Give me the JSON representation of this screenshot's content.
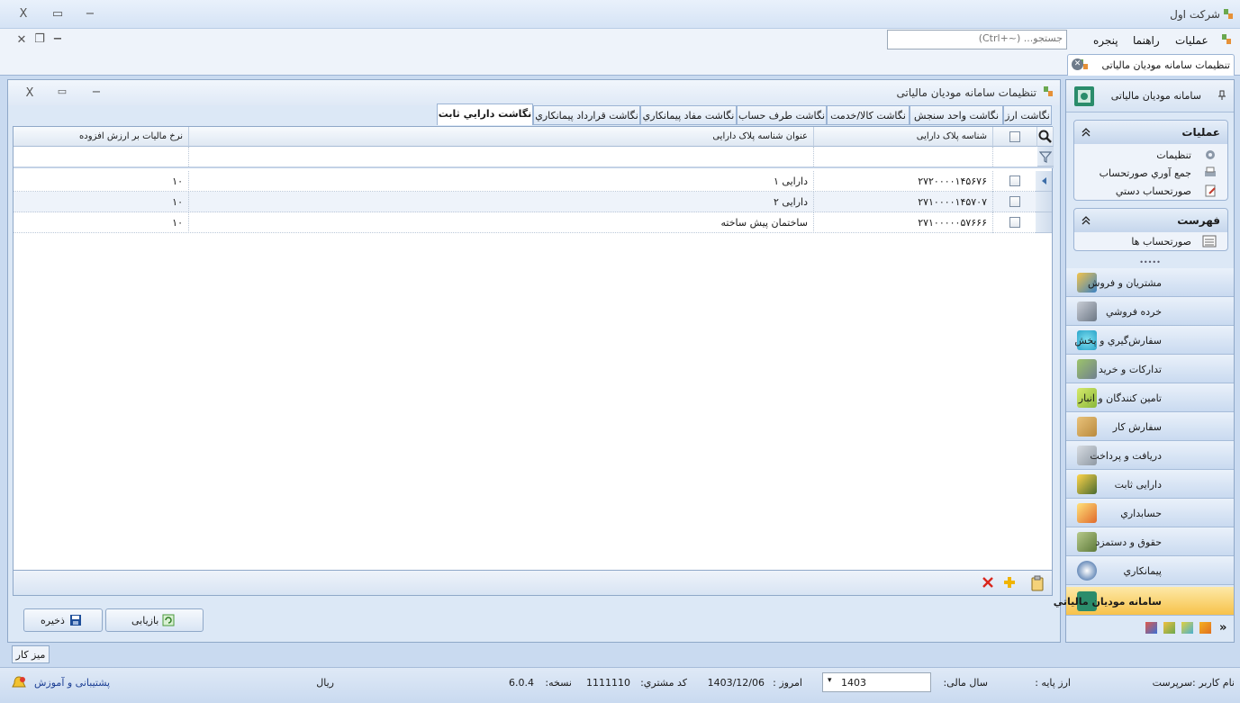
{
  "window": {
    "title": "شرکت اول",
    "min_glyph": "−",
    "max_glyph": "▭",
    "close_glyph": "X"
  },
  "mdi_controls": {
    "close_glyph": "✕",
    "restore_glyph": "❐",
    "min_glyph": "−"
  },
  "menu": {
    "items": [
      "عملیات",
      "راهنما",
      "پنجره"
    ]
  },
  "search": {
    "placeholder": "جستجو... (~+Ctrl)"
  },
  "doc_tab": {
    "label": "تنظیمات سامانه مودیان مالیاتی",
    "close_glyph": "✕"
  },
  "dialog": {
    "title": "تنظیمات سامانه مودیان مالیاتی",
    "close_glyph": "X",
    "restore_glyph": "▭",
    "min_glyph": "−"
  },
  "subtabs": [
    "نگاشت ارز",
    "نگاشت واحد سنجش",
    "نگاشت کالا/خدمت",
    "نگاشت طرف حساب",
    "نگاشت مفاد پیمانکاري",
    "نگاشت قرارداد پیمانکاري",
    "نگاشت دارايي ثابت"
  ],
  "grid": {
    "columns": [
      "شناسه پلاک دارایی",
      "عنوان شناسه پلاک دارایی",
      "نرخ مالیات بر ارزش افزوده"
    ],
    "rows": [
      {
        "id": "۲۷۲۰۰۰۰۱۴۵۶۷۶",
        "title": "دارایی ۱",
        "rate": "۱۰"
      },
      {
        "id": "۲۷۱۰۰۰۰۱۴۵۷۰۷",
        "title": "دارایی ۲",
        "rate": "۱۰"
      },
      {
        "id": "۲۷۱۰۰۰۰۰۵۷۶۶۶",
        "title": "ساختمان پیش ساخته",
        "rate": "۱۰"
      }
    ]
  },
  "buttons": {
    "save": "ذخیره",
    "reload": "بازیابی"
  },
  "nav": {
    "pane_title": "سامانه مودیان مالیاتی",
    "ops_header": "عملیات",
    "ops_links": [
      "تنظیمات",
      "جمع آوري صورتحساب",
      "صورتحساب دستي"
    ],
    "list_header": "فهرست",
    "list_links": [
      "صورتحساب ها"
    ],
    "grip": "•••••",
    "modules": [
      "مشتریان و فروش",
      "خرده فروشي",
      "سفارش‌گيري و پخش",
      "تدارکات و خرید",
      "تامین کنندگان و انبار",
      "سفارش کار",
      "دریافت و پرداخت",
      "دارایی ثابت",
      "حسابداري",
      "حقوق و دستمزد",
      "پیمانکاري",
      "سامانه مودیان مالیاتي"
    ],
    "active_module": 11,
    "more_glyph": "»"
  },
  "desk_tab": "میز کار",
  "status": {
    "user_label": "نام کاربر :سرپرست",
    "base_currency_label": "ارز پایه :",
    "base_currency": "ریال",
    "fiscal_year_label": "سال مالی:",
    "fiscal_year": "1403",
    "today_label": "امروز :",
    "today": "1403/12/06",
    "customer_code_label": "کد مشتري:",
    "customer_code": "1111110",
    "version_label": "نسخه:",
    "version": "6.0.4",
    "support": "پشتیبانی و آموزش"
  }
}
